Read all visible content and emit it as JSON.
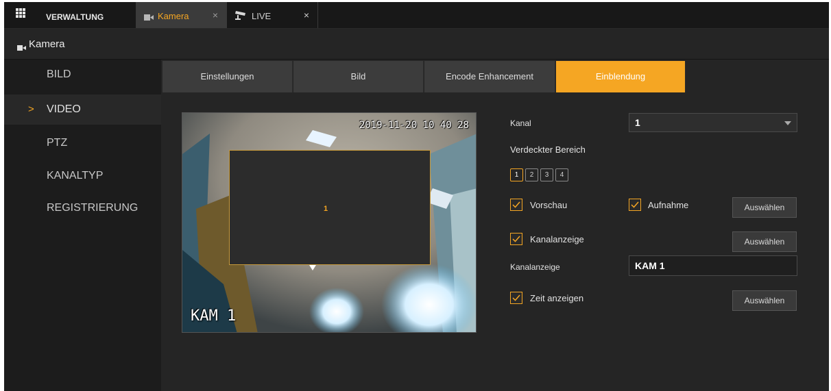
{
  "topbar": {
    "brand": "VERWALTUNG",
    "tabs": [
      {
        "label": "Kamera",
        "icon": "camera-icon",
        "close": "×",
        "active": true
      },
      {
        "label": "LIVE",
        "icon": "cctv-icon",
        "close": "×",
        "active": false
      }
    ]
  },
  "page": {
    "title": "Kamera",
    "icon": "camera-icon"
  },
  "sidebar": {
    "items": [
      {
        "label": "BILD",
        "active": false
      },
      {
        "label": "VIDEO",
        "active": true,
        "chevron": ">"
      },
      {
        "label": "PTZ",
        "active": false
      },
      {
        "label": "KANALTYP",
        "active": false
      },
      {
        "label": "REGISTRIERUNG",
        "active": false
      }
    ]
  },
  "subtabs": [
    {
      "label": "Einstellungen",
      "active": false
    },
    {
      "label": "Bild",
      "active": false
    },
    {
      "label": "Encode Enhancement",
      "active": false
    },
    {
      "label": "Einblendung",
      "active": true
    }
  ],
  "preview": {
    "timestamp": "2019-11-20 10 40 28",
    "channel_name": "KAM 1",
    "mask_number": "1"
  },
  "form": {
    "kanal_label": "Kanal",
    "kanal_value": "1",
    "region_label": "Verdeckter Bereich",
    "regions": [
      "1",
      "2",
      "3",
      "4"
    ],
    "active_region": "1",
    "vorschau_label": "Vorschau",
    "vorschau_checked": true,
    "aufnahme_label": "Aufnahme",
    "aufnahme_checked": true,
    "kanalanzeige_cb_label": "Kanalanzeige",
    "kanalanzeige_checked": true,
    "kanalanzeige_field_label": "Kanalanzeige",
    "kanalanzeige_value": "KAM 1",
    "zeit_label": "Zeit anzeigen",
    "zeit_checked": true,
    "select_button_label": "Auswählen"
  },
  "colors": {
    "accent": "#f5a623",
    "background": "#252525",
    "sidebar": "#1c1c1c"
  }
}
